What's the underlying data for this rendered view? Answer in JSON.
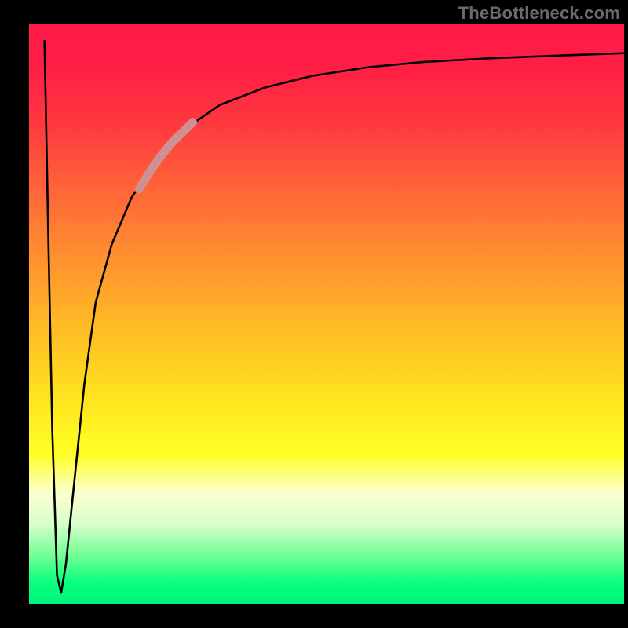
{
  "watermark": "TheBottleneck.com",
  "chart_data": {
    "type": "line",
    "title": "",
    "xlabel": "",
    "ylabel": "",
    "xlim": [
      0,
      100
    ],
    "ylim": [
      0,
      100
    ],
    "grid": false,
    "legend": false,
    "note": "Axes are unlabeled in the source image. x/y values below are estimated from pixel position on a 0–100 scale in each direction (0 = left/bottom, 100 = right/top).",
    "series": [
      {
        "name": "curve",
        "color": "#000000",
        "x": [
          2.6,
          3.2,
          3.9,
          4.7,
          5.4,
          6.2,
          7.5,
          9.3,
          11.2,
          13.9,
          17.2,
          21.1,
          26.4,
          32.1,
          39.7,
          47.6,
          57.1,
          66.5,
          77.1,
          86.8,
          94.7,
          100.0
        ],
        "y": [
          97.0,
          65.0,
          30.0,
          5.0,
          2.0,
          7.0,
          20.0,
          38.0,
          52.0,
          62.0,
          70.0,
          76.0,
          82.0,
          86.0,
          89.0,
          91.0,
          92.5,
          93.4,
          94.0,
          94.4,
          94.7,
          94.9
        ]
      },
      {
        "name": "highlight-segment",
        "color": "#cf8f93",
        "thick": true,
        "x": [
          18.5,
          20.0,
          22.0,
          24.0,
          26.0,
          27.5
        ],
        "y": [
          71.5,
          74.0,
          77.0,
          79.5,
          81.5,
          83.0
        ]
      }
    ],
    "background_gradient_stops": [
      {
        "pos": 0.0,
        "color": "#ff1948"
      },
      {
        "pos": 0.3,
        "color": "#ff6a37"
      },
      {
        "pos": 0.5,
        "color": "#ffb327"
      },
      {
        "pos": 0.74,
        "color": "#ffff24"
      },
      {
        "pos": 0.86,
        "color": "#d9ffca"
      },
      {
        "pos": 1.0,
        "color": "#00f47c"
      }
    ]
  }
}
